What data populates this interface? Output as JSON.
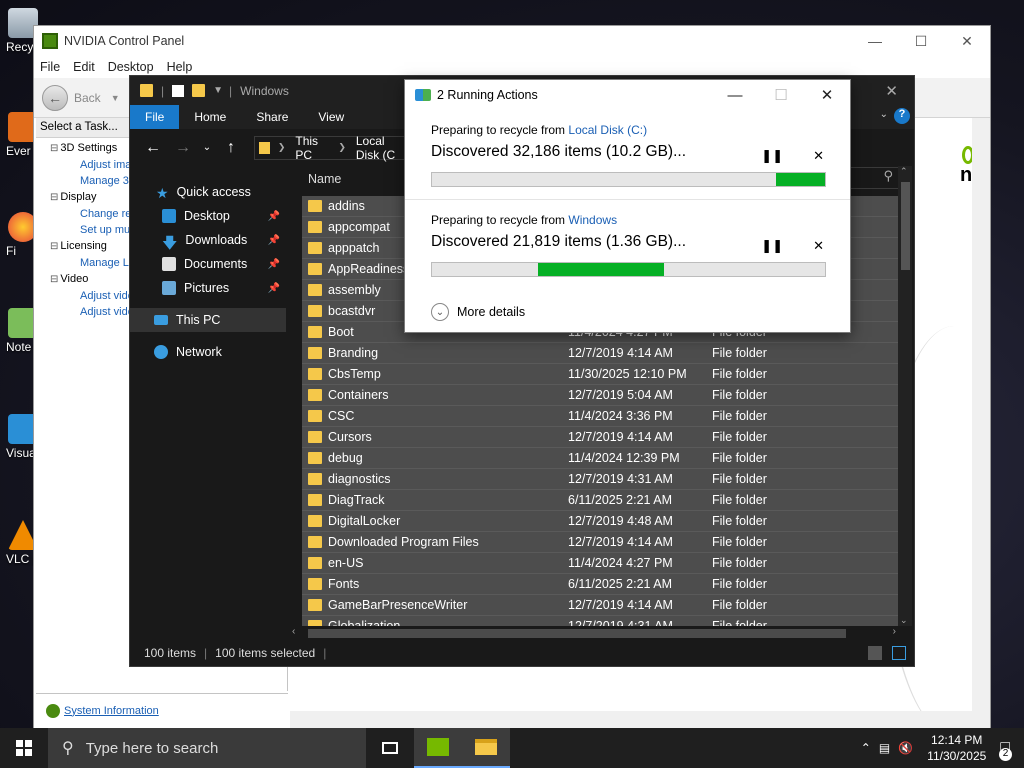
{
  "desktop_icons": [
    {
      "label": "Recy",
      "icon": "recycle-bin-icon"
    },
    {
      "label": "Ever",
      "icon": "app-icon"
    },
    {
      "label": "Fi",
      "icon": "firefox-icon"
    },
    {
      "label": "Note",
      "icon": "notepad-icon"
    },
    {
      "label": "Visua C",
      "icon": "visual-studio-icon"
    },
    {
      "label": "VLC pl",
      "icon": "vlc-icon"
    }
  ],
  "nvidia": {
    "title": "NVIDIA Control Panel",
    "menu": [
      "File",
      "Edit",
      "Desktop",
      "Help"
    ],
    "back_label": "Back",
    "task_header": "Select a Task...",
    "tree": [
      {
        "category": "3D Settings",
        "items": [
          "Adjust ima",
          "Manage 3D"
        ]
      },
      {
        "category": "Display",
        "items": [
          "Change re",
          "Set up mul"
        ]
      },
      {
        "category": "Licensing",
        "items": [
          "Manage Lic"
        ]
      },
      {
        "category": "Video",
        "items": [
          "Adjust vide",
          "Adjust vide"
        ]
      }
    ],
    "system_info_link": "System Information",
    "brand_text": "n"
  },
  "explorer": {
    "title": "Windows",
    "ribbon_tabs": [
      "File",
      "Home",
      "Share",
      "View"
    ],
    "breadcrumb": [
      "This PC",
      "Local Disk (C"
    ],
    "sidebar": [
      {
        "label": "Quick access",
        "icon": "star-icon",
        "pinned": false
      },
      {
        "label": "Desktop",
        "icon": "desktop-icon",
        "pinned": true
      },
      {
        "label": "Downloads",
        "icon": "download-icon",
        "pinned": true
      },
      {
        "label": "Documents",
        "icon": "documents-icon",
        "pinned": true
      },
      {
        "label": "Pictures",
        "icon": "pictures-icon",
        "pinned": true
      },
      {
        "label": "This PC",
        "icon": "computer-icon",
        "pinned": false
      },
      {
        "label": "Network",
        "icon": "network-icon",
        "pinned": false
      }
    ],
    "column_name": "Name",
    "files": [
      {
        "name": "addins",
        "date": "",
        "type": ""
      },
      {
        "name": "appcompat",
        "date": "",
        "type": ""
      },
      {
        "name": "apppatch",
        "date": "",
        "type": ""
      },
      {
        "name": "AppReadiness",
        "date": "",
        "type": ""
      },
      {
        "name": "assembly",
        "date": "",
        "type": ""
      },
      {
        "name": "bcastdvr",
        "date": "",
        "type": ""
      },
      {
        "name": "Boot",
        "date": "11/4/2024 4:27 PM",
        "type": "File folder"
      },
      {
        "name": "Branding",
        "date": "12/7/2019 4:14 AM",
        "type": "File folder"
      },
      {
        "name": "CbsTemp",
        "date": "11/30/2025 12:10 PM",
        "type": "File folder"
      },
      {
        "name": "Containers",
        "date": "12/7/2019 5:04 AM",
        "type": "File folder"
      },
      {
        "name": "CSC",
        "date": "11/4/2024 3:36 PM",
        "type": "File folder"
      },
      {
        "name": "Cursors",
        "date": "12/7/2019 4:14 AM",
        "type": "File folder"
      },
      {
        "name": "debug",
        "date": "11/4/2024 12:39 PM",
        "type": "File folder"
      },
      {
        "name": "diagnostics",
        "date": "12/7/2019 4:31 AM",
        "type": "File folder"
      },
      {
        "name": "DiagTrack",
        "date": "6/11/2025 2:21 AM",
        "type": "File folder"
      },
      {
        "name": "DigitalLocker",
        "date": "12/7/2019 4:48 AM",
        "type": "File folder"
      },
      {
        "name": "Downloaded Program Files",
        "date": "12/7/2019 4:14 AM",
        "type": "File folder"
      },
      {
        "name": "en-US",
        "date": "11/4/2024 4:27 PM",
        "type": "File folder"
      },
      {
        "name": "Fonts",
        "date": "6/11/2025 2:21 AM",
        "type": "File folder"
      },
      {
        "name": "GameBarPresenceWriter",
        "date": "12/7/2019 4:14 AM",
        "type": "File folder"
      },
      {
        "name": "Globalization",
        "date": "12/7/2019 4:31 AM",
        "type": "File folder"
      }
    ],
    "status_count": "100 items",
    "status_selected": "100 items selected"
  },
  "dialog": {
    "title": "2 Running Actions",
    "ops": [
      {
        "prefix": "Preparing to recycle from ",
        "source": "Local Disk (C:)",
        "status": "Discovered 32,186 items (10.2 GB)...",
        "progress_start": 0.875,
        "progress_end": 1.0
      },
      {
        "prefix": "Preparing to recycle from ",
        "source": "Windows",
        "status": "Discovered 21,819 items (1.36 GB)...",
        "progress_start": 0.27,
        "progress_end": 0.59
      }
    ],
    "more_details": "More details"
  },
  "taskbar": {
    "search_placeholder": "Type here to search",
    "time": "12:14 PM",
    "date": "11/30/2025",
    "notifications": "2"
  }
}
